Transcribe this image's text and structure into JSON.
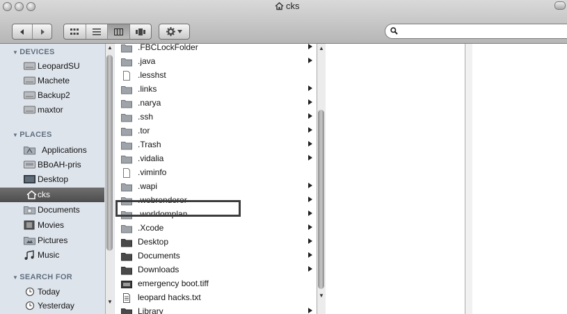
{
  "window": {
    "title": "cks"
  },
  "toolbar": {
    "view_modes": [
      "icon-view",
      "list-view",
      "column-view",
      "cover-flow-view"
    ],
    "selected_view": "column-view",
    "action_button": "gear-icon",
    "search": {
      "value": "",
      "placeholder": ""
    }
  },
  "sidebar": {
    "sections": [
      {
        "label": "DEVICES",
        "items": [
          {
            "label": "LeopardSU",
            "icon": "hard-drive-icon"
          },
          {
            "label": "Machete",
            "icon": "hard-drive-icon"
          },
          {
            "label": "Backup2",
            "icon": "hard-drive-icon"
          },
          {
            "label": "maxtor",
            "icon": "hard-drive-icon"
          }
        ]
      },
      {
        "label": "PLACES",
        "items": [
          {
            "label": "Applications",
            "icon": "applications-folder-icon"
          },
          {
            "label": "BBoAH-pris",
            "icon": "network-drive-icon"
          },
          {
            "label": "Desktop",
            "icon": "desktop-icon"
          },
          {
            "label": "cks",
            "icon": "home-icon",
            "selected": true
          },
          {
            "label": "Documents",
            "icon": "documents-folder-icon"
          },
          {
            "label": "Movies",
            "icon": "movies-folder-icon"
          },
          {
            "label": "Pictures",
            "icon": "pictures-folder-icon"
          },
          {
            "label": "Music",
            "icon": "music-icon"
          }
        ]
      },
      {
        "label": "SEARCH FOR",
        "items": [
          {
            "label": "Today",
            "icon": "clock-icon"
          },
          {
            "label": "Yesterday",
            "icon": "clock-icon"
          }
        ]
      }
    ]
  },
  "column1": {
    "items": [
      {
        "label": ".FBCLockFolder",
        "type": "folder",
        "arrow": true
      },
      {
        "label": ".java",
        "type": "folder",
        "arrow": true
      },
      {
        "label": ".lesshst",
        "type": "file",
        "arrow": false
      },
      {
        "label": ".links",
        "type": "folder",
        "arrow": true
      },
      {
        "label": ".narya",
        "type": "folder",
        "arrow": true
      },
      {
        "label": ".ssh",
        "type": "folder",
        "arrow": true
      },
      {
        "label": ".tor",
        "type": "folder",
        "arrow": true
      },
      {
        "label": ".Trash",
        "type": "folder",
        "arrow": true
      },
      {
        "label": ".vidalia",
        "type": "folder",
        "arrow": true
      },
      {
        "label": ".viminfo",
        "type": "file",
        "arrow": false
      },
      {
        "label": ".wapi",
        "type": "folder",
        "arrow": true
      },
      {
        "label": ".webrenderer",
        "type": "folder",
        "arrow": true
      },
      {
        "label": ".worldomplan",
        "type": "folder",
        "arrow": true,
        "highlighted": true
      },
      {
        "label": ".Xcode",
        "type": "folder",
        "arrow": true
      },
      {
        "label": "Desktop",
        "type": "folder-dark",
        "arrow": true
      },
      {
        "label": "Documents",
        "type": "folder-dark",
        "arrow": true
      },
      {
        "label": "Downloads",
        "type": "folder-dark",
        "arrow": true
      },
      {
        "label": "emergency boot.tiff",
        "type": "image-file",
        "arrow": false
      },
      {
        "label": "leopard hacks.txt",
        "type": "text-file",
        "arrow": false
      },
      {
        "label": "Library",
        "type": "folder-dark",
        "arrow": true
      }
    ]
  },
  "colors": {
    "sidebar_bg": "#dee4ec",
    "sidebar_header": "#5f6f80",
    "sidebar_selected": "#555555",
    "folder": "#9fa4aa",
    "folder_dark": "#4a4a4a"
  }
}
